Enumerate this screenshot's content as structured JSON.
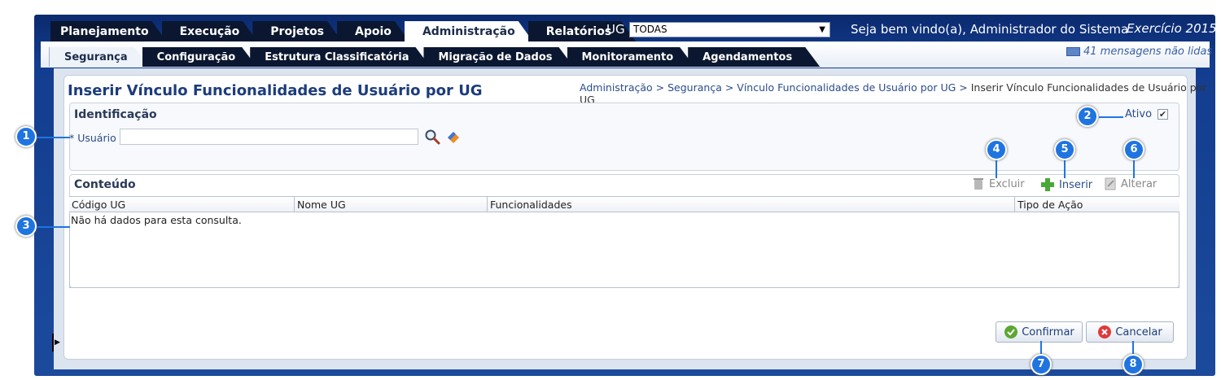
{
  "top_tabs": [
    "Planejamento",
    "Execução",
    "Projetos",
    "Apoio",
    "Administração",
    "Relatórios"
  ],
  "ug": {
    "label": "UG",
    "selected": "TODAS"
  },
  "welcome": "Seja bem vindo(a), Administrador do Sistema",
  "exercicio": "Exercício 2015",
  "sub_tabs": [
    "Segurança",
    "Configuração",
    "Estrutura Classificatória",
    "Migração de Dados",
    "Monitoramento",
    "Agendamentos"
  ],
  "messages": "41 mensagens não lidas",
  "page_title": "Inserir Vínculo Funcionalidades de Usuário por UG",
  "breadcrumb": {
    "path": "Administração > Segurança > Vínculo Funcionalidades de Usuário por UG > ",
    "current": "Inserir Vínculo Funcionalidades de Usuário por UG"
  },
  "identificacao": {
    "title": "Identificação",
    "usuario_label": "* Usuário",
    "usuario_value": "",
    "ativo_label": "Ativo",
    "ativo_checked": true
  },
  "conteudo": {
    "title": "Conteúdo",
    "excluir": "Excluir",
    "inserir": "Inserir",
    "alterar": "Alterar",
    "columns": [
      "Código UG",
      "Nome UG",
      "Funcionalidades",
      "Tipo de Ação"
    ],
    "empty": "Não há dados para esta consulta."
  },
  "buttons": {
    "confirmar": "Confirmar",
    "cancelar": "Cancelar"
  },
  "callouts": [
    "1",
    "2",
    "3",
    "4",
    "5",
    "6",
    "7",
    "8"
  ],
  "colors": {
    "callout": "#1f74e0",
    "nav_dark": "#0b1730",
    "frame": "#133d8f"
  }
}
